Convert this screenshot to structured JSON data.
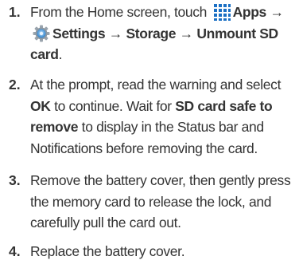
{
  "steps": [
    {
      "number": "1.",
      "pre": "From the Home screen, touch",
      "apps": "Apps",
      "arrow": "→",
      "settings": "Settings",
      "storage": "Storage",
      "unmount": "Unmount SD card",
      "end": "."
    },
    {
      "number": "2.",
      "t1": "At the prompt, read the warning and select ",
      "ok": "OK",
      "t2": " to continue. Wait for ",
      "safe": "SD card safe to remove",
      "t3": " to display in the Status bar and Notifications before removing the card."
    },
    {
      "number": "3.",
      "text": "Remove the battery cover, then gently press the memory card to release the lock, and carefully pull the card out."
    },
    {
      "number": "4.",
      "text": "Replace the battery cover."
    }
  ],
  "icons": {
    "apps": "apps-grid-icon",
    "settings": "settings-gear-icon"
  },
  "colors": {
    "text": "#333333",
    "apps_icon": "#1a6fc4",
    "settings_icon": "#2a7fc9"
  }
}
